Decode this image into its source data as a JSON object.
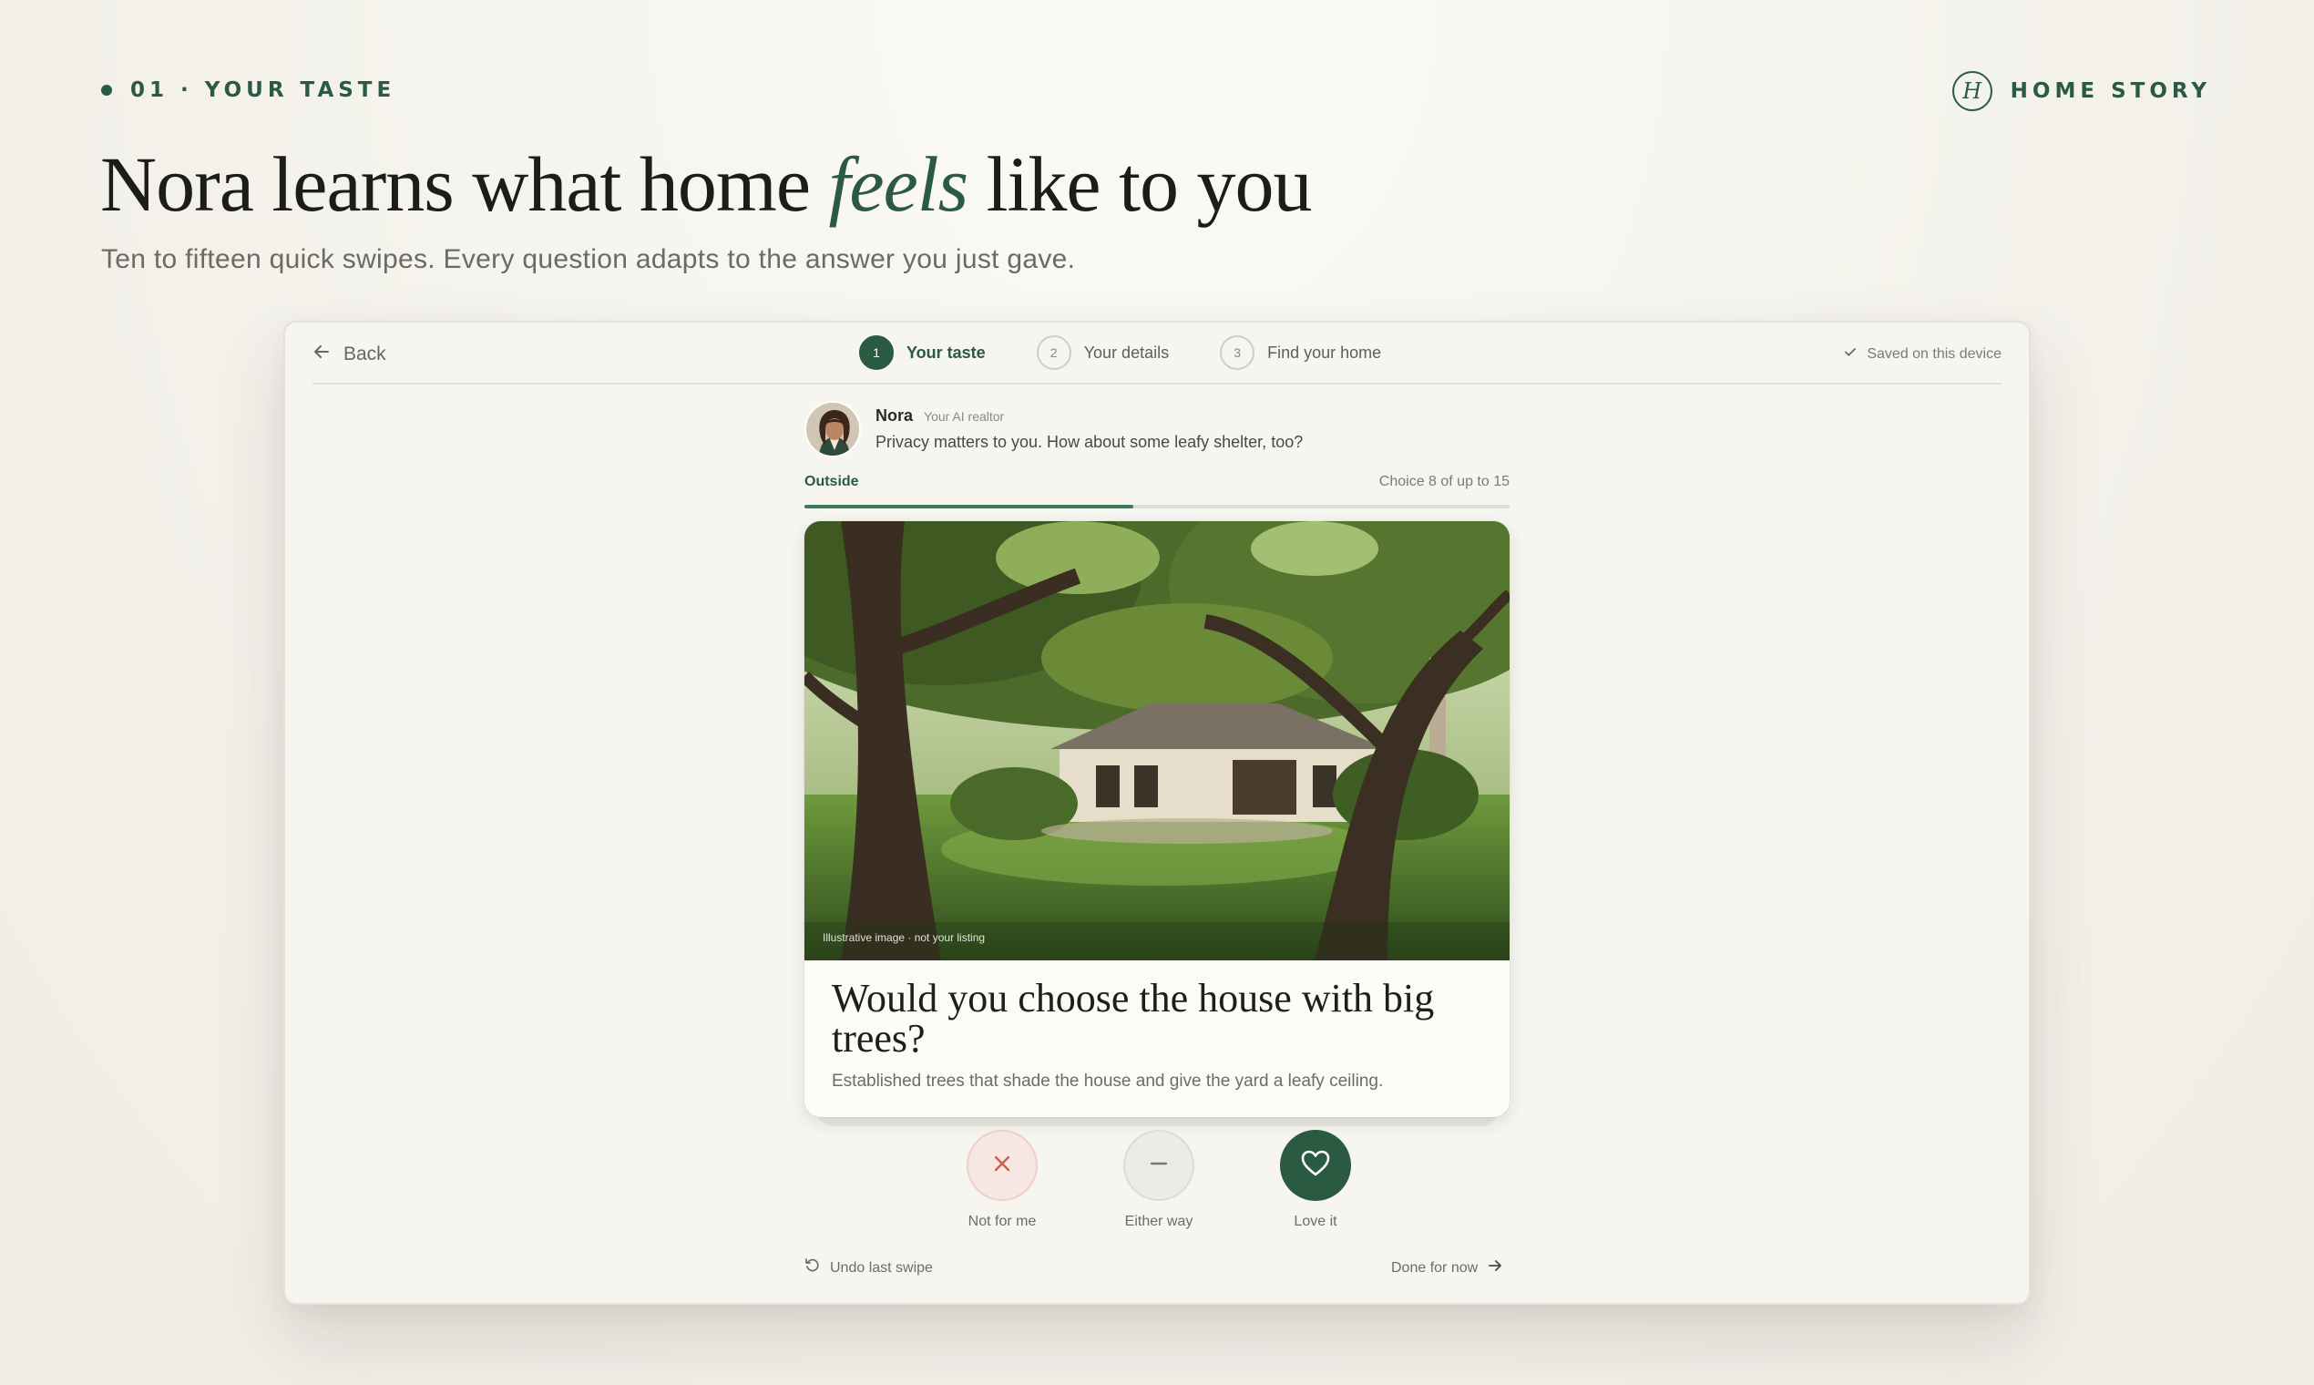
{
  "header": {
    "eyebrow": "01 · YOUR TASTE",
    "brand_monogram": "H",
    "brand_name": "HOME STORY",
    "title_before": "Nora learns what home ",
    "title_emphasis": "feels",
    "title_after": " like to you",
    "subtitle": "Ten to fifteen quick swipes. Every question adapts to the answer you just gave."
  },
  "topbar": {
    "back_label": "Back",
    "steps": [
      {
        "num": "1",
        "label": "Your taste",
        "active": true
      },
      {
        "num": "2",
        "label": "Your details",
        "active": false
      },
      {
        "num": "3",
        "label": "Find your home",
        "active": false
      }
    ],
    "saved_label": "Saved on this device"
  },
  "agent": {
    "name": "Nora",
    "role": "Your AI realtor",
    "message": "Privacy matters to you. How about some leafy shelter, too?"
  },
  "progress": {
    "category": "Outside",
    "count_label": "Choice 8 of up to 15",
    "fraction": 0.467
  },
  "card": {
    "image_caption": "Illustrative image · not your listing",
    "question": "Would you choose the house with big trees?",
    "description": "Established trees that shade the house and give the yard a leafy ceiling."
  },
  "actions": {
    "no_label": "Not for me",
    "neutral_label": "Either way",
    "yes_label": "Love it"
  },
  "footer": {
    "undo_label": "Undo last swipe",
    "done_label": "Done for now"
  },
  "colors": {
    "accent": "#2b5a43",
    "progress_fill": "#3d7a58",
    "no_icon": "#c9604f"
  },
  "icons": {
    "back": "arrow-left-icon",
    "saved": "check-icon",
    "no": "close-icon",
    "neutral": "minus-icon",
    "yes": "heart-icon",
    "undo": "undo-icon",
    "done": "arrow-right-icon"
  }
}
